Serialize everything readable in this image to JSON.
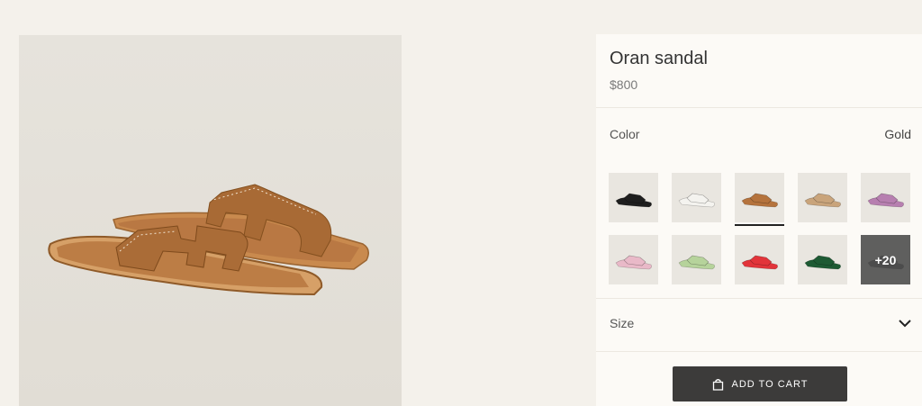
{
  "product": {
    "title": "Oran sandal",
    "price": "$800"
  },
  "color": {
    "label": "Color",
    "value": "Gold",
    "swatches": [
      {
        "name": "black",
        "hex": "#1e1e1e",
        "selected": false
      },
      {
        "name": "white",
        "hex": "#f4f3ef",
        "selected": false
      },
      {
        "name": "gold",
        "hex": "#b5733d",
        "selected": true
      },
      {
        "name": "natural",
        "hex": "#c9a47b",
        "selected": false
      },
      {
        "name": "mauve",
        "hex": "#b77fb0",
        "selected": false
      },
      {
        "name": "pink",
        "hex": "#e9b9c8",
        "selected": false
      },
      {
        "name": "light-green",
        "hex": "#b6d39b",
        "selected": false
      },
      {
        "name": "red",
        "hex": "#e2343a",
        "selected": false
      },
      {
        "name": "dark-green",
        "hex": "#1d5a33",
        "selected": false
      },
      {
        "name": "more",
        "hex": "#6b6b6b",
        "selected": false,
        "overlay": "+20"
      }
    ]
  },
  "size": {
    "label": "Size",
    "icon": "chevron-down-icon"
  },
  "cart": {
    "label": "ADD TO CART",
    "icon": "shopping-bag-icon"
  },
  "colors": {
    "page_bg": "#f4f1eb",
    "panel_bg": "#fcfaf6",
    "button_bg": "#3c3b3a",
    "leather": "#b5733d"
  }
}
